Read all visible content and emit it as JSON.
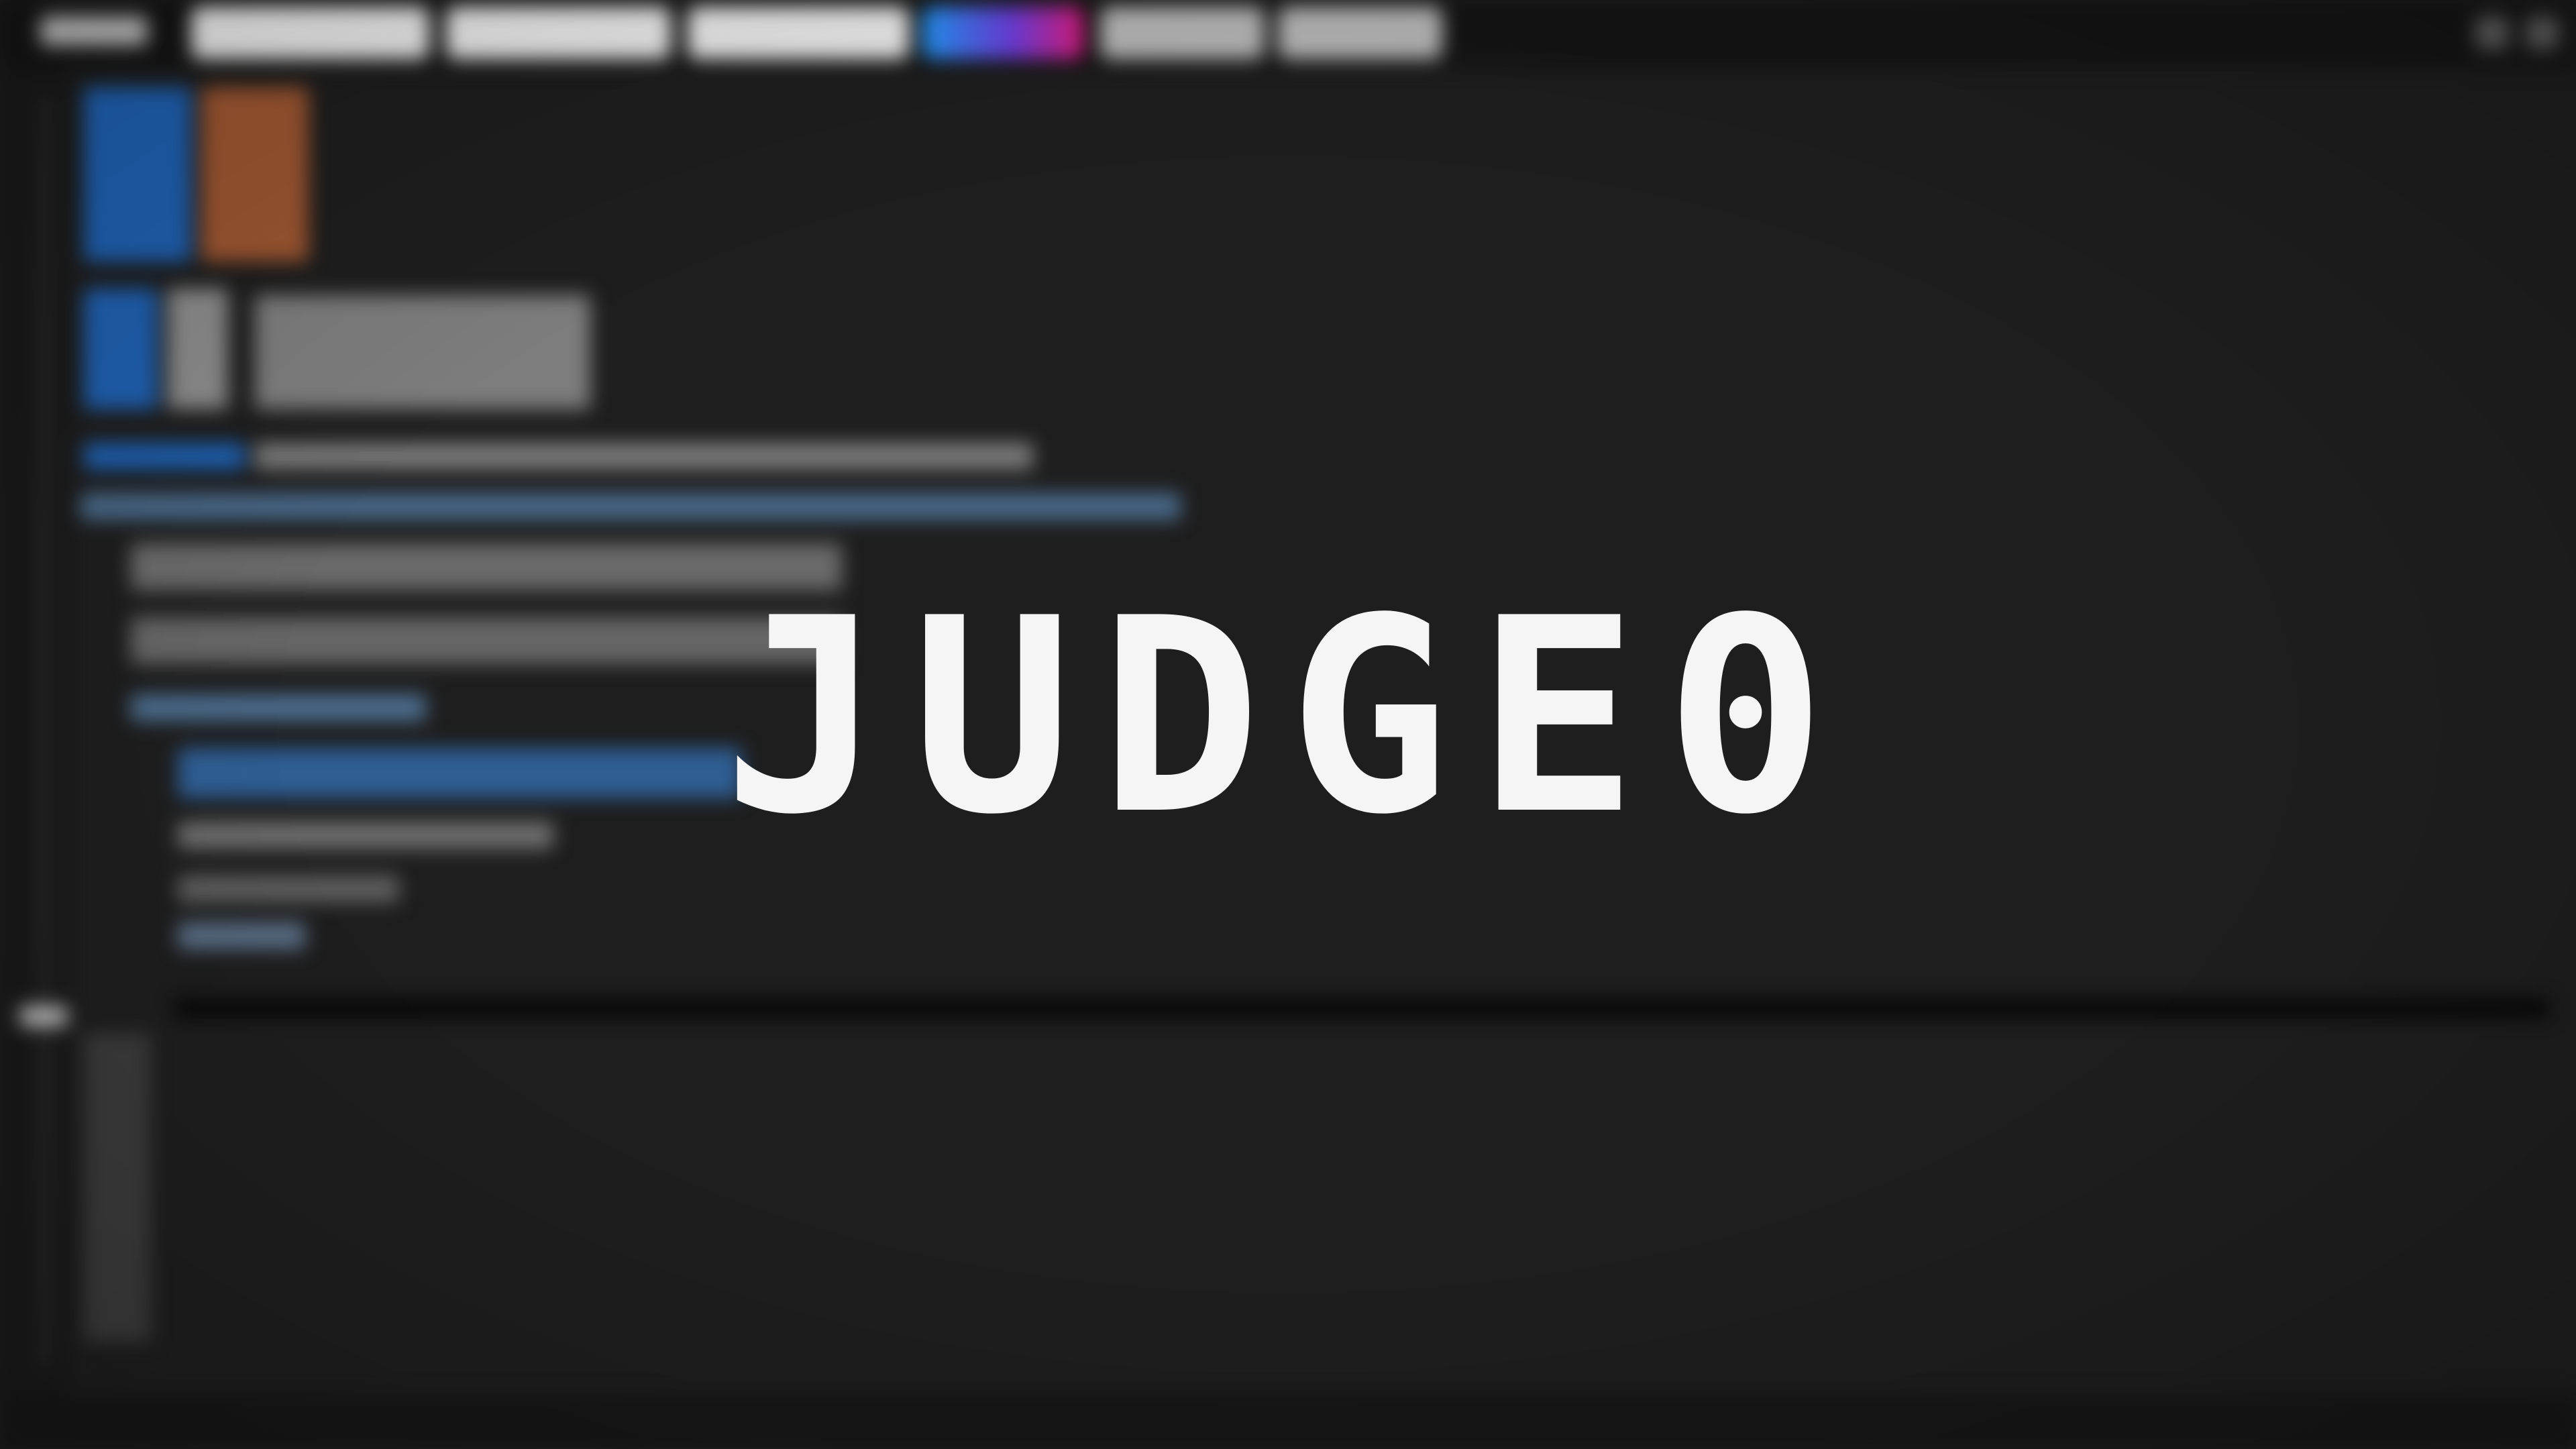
{
  "app": {
    "logo_text": "JUDGE0"
  },
  "colors": {
    "background": "#1e1e1e",
    "logo": "#f5f5f5",
    "keyword_blue": "#2a6fc4",
    "string_orange": "#b0643a",
    "accent_tab_gradient": [
      "#2196f3",
      "#6a3ddb",
      "#d81b7a"
    ]
  },
  "icons": {
    "window_buttons": [
      "settings-icon",
      "close-icon"
    ]
  }
}
